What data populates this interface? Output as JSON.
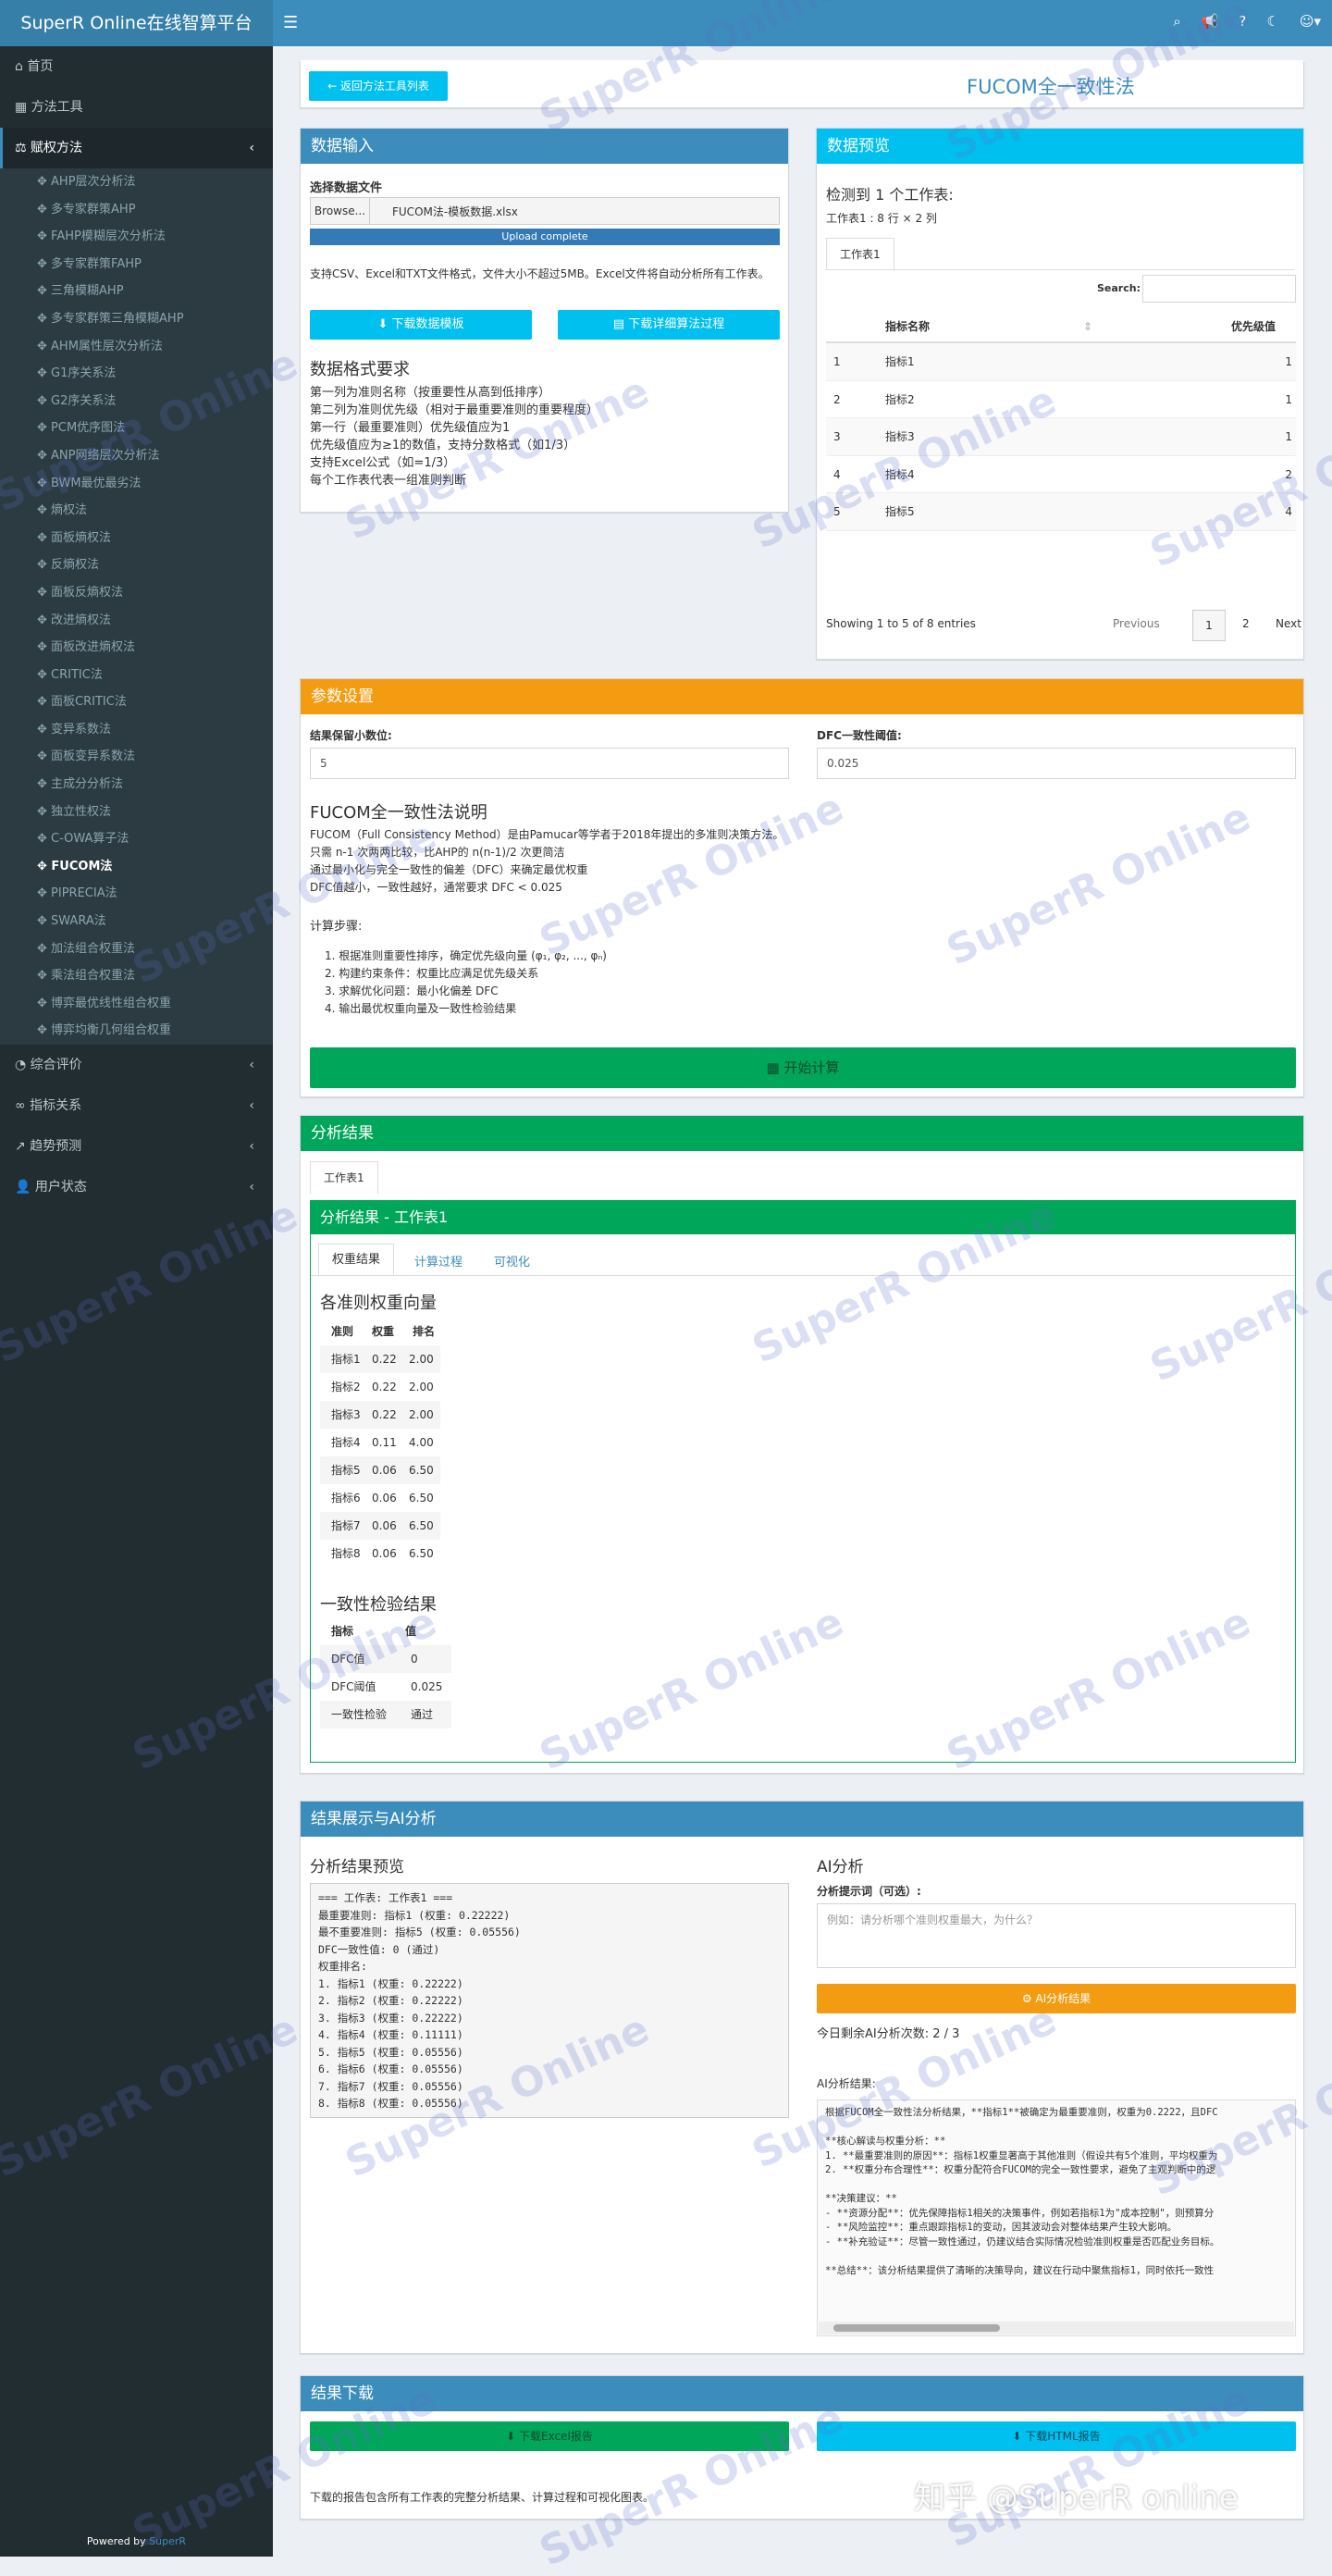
{
  "app": {
    "title": "SuperR Online在线智算平台",
    "powered": "Powered by",
    "powered_brand": "SuperR"
  },
  "sidebar": {
    "top": [
      {
        "label": "首页",
        "icon": "home-icon"
      },
      {
        "label": "方法工具",
        "icon": "table-icon"
      },
      {
        "label": "赋权方法",
        "icon": "balance-icon"
      }
    ],
    "sub": [
      "AHP层次分析法",
      "多专家群策AHP",
      "FAHP模糊层次分析法",
      "多专家群策FAHP",
      "三角模糊AHP",
      "多专家群策三角模糊AHP",
      "AHM属性层次分析法",
      "G1序关系法",
      "G2序关系法",
      "PCM优序图法",
      "ANP网络层次分析法",
      "BWM最优最劣法",
      "熵权法",
      "面板熵权法",
      "反熵权法",
      "面板反熵权法",
      "改进熵权法",
      "面板改进熵权法",
      "CRITIC法",
      "面板CRITIC法",
      "变异系数法",
      "面板变异系数法",
      "主成分分析法",
      "独立性权法",
      "C-OWA算子法",
      "FUCOM法",
      "PIPRECIA法",
      "SWARA法",
      "加法组合权重法",
      "乘法组合权重法",
      "博弈最优线性组合权重",
      "博弈均衡几何组合权重"
    ],
    "bottom": [
      {
        "label": "综合评价",
        "icon": "chart-pie-icon"
      },
      {
        "label": "指标关系",
        "icon": "link-icon"
      },
      {
        "label": "趋势预测",
        "icon": "line-chart-icon"
      },
      {
        "label": "用户状态",
        "icon": "user-icon"
      }
    ]
  },
  "header": {
    "back_label": "← 返回方法工具列表",
    "page_title": "FUCOM全一致性法"
  },
  "data_input": {
    "title": "数据输入",
    "file_label": "选择数据文件",
    "browse": "Browse...",
    "file_name": "FUCOM法-模板数据.xlsx",
    "upload_status": "Upload complete",
    "support_note": "支持CSV、Excel和TXT文件格式，文件大小不超过5MB。Excel文件将自动分析所有工作表。",
    "btn_template": "下载数据模板",
    "btn_process": "下载详细算法过程",
    "format_title": "数据格式要求",
    "format_lines": [
      "第一列为准则名称（按重要性从高到低排序）",
      "第二列为准则优先级（相对于最重要准则的重要程度）",
      "第一行（最重要准则）优先级值应为1",
      "优先级值应为≥1的数值，支持分数格式（如1/3）",
      "支持Excel公式（如=1/3）",
      "每个工作表代表一组准则判断"
    ]
  },
  "data_preview": {
    "title": "数据预览",
    "detected": "检测到 1 个工作表:",
    "sheet_info": "工作表1 : 8 行 × 2 列",
    "tab": "工作表1",
    "search_label": "Search:",
    "columns": [
      "",
      "指标名称",
      "优先级值"
    ],
    "rows": [
      [
        "1",
        "指标1",
        "1"
      ],
      [
        "2",
        "指标2",
        "1"
      ],
      [
        "3",
        "指标3",
        "1"
      ],
      [
        "4",
        "指标4",
        "2"
      ],
      [
        "5",
        "指标5",
        "4"
      ]
    ],
    "entries": "Showing 1 to 5 of 8 entries",
    "prev": "Previous",
    "pages": [
      "1",
      "2"
    ],
    "next": "Next"
  },
  "params": {
    "title": "参数设置",
    "decimal_label": "结果保留小数位:",
    "decimal_value": "5",
    "dfc_label": "DFC一致性阈值:",
    "dfc_value": "0.025",
    "desc_title": "FUCOM全一致性法说明",
    "desc_lines": [
      "FUCOM（Full Consistency Method）是由Pamucar等学者于2018年提出的多准则决策方法。",
      "只需 n-1 次两两比较，比AHP的 n(n-1)/2 次更简洁",
      "通过最小化与完全一致性的偏差（DFC）来确定最优权重",
      "DFC值越小，一致性越好，通常要求 DFC < 0.025"
    ],
    "steps_title": "计算步骤:",
    "steps": [
      "1. 根据准则重要性排序，确定优先级向量 (φ₁, φ₂, ..., φₙ)",
      "2. 构建约束条件：权重比应满足优先级关系",
      "3. 求解优化问题：最小化偏差 DFC",
      "4. 输出最优权重向量及一致性检验结果"
    ],
    "start_btn": "开始计算"
  },
  "results": {
    "title": "分析结果",
    "tab": "工作表1",
    "sub_title": "分析结果 - 工作表1",
    "inner_tabs": [
      "权重结果",
      "计算过程",
      "可视化"
    ],
    "weights_title": "各准则权重向量",
    "weights_cols": [
      "准则",
      "权重",
      "排名"
    ],
    "weights": [
      [
        "指标1",
        "0.22",
        "2.00"
      ],
      [
        "指标2",
        "0.22",
        "2.00"
      ],
      [
        "指标3",
        "0.22",
        "2.00"
      ],
      [
        "指标4",
        "0.11",
        "4.00"
      ],
      [
        "指标5",
        "0.06",
        "6.50"
      ],
      [
        "指标6",
        "0.06",
        "6.50"
      ],
      [
        "指标7",
        "0.06",
        "6.50"
      ],
      [
        "指标8",
        "0.06",
        "6.50"
      ]
    ],
    "check_title": "一致性检验结果",
    "check_cols": [
      "指标",
      "值"
    ],
    "check": [
      [
        "DFC值",
        "0"
      ],
      [
        "DFC阈值",
        "0.025"
      ],
      [
        "一致性检验",
        "通过"
      ]
    ]
  },
  "ai": {
    "title": "结果展示与AI分析",
    "preview_title": "分析结果预览",
    "preview_text": "=== 工作表: 工作表1 ===\n最重要准则: 指标1 (权重: 0.22222)\n最不重要准则: 指标5 (权重: 0.05556)\nDFC一致性值: 0 (通过)\n权重排名:\n1. 指标1 (权重: 0.22222)\n2. 指标2 (权重: 0.22222)\n3. 指标3 (权重: 0.22222)\n4. 指标4 (权重: 0.11111)\n5. 指标5 (权重: 0.05556)\n6. 指标6 (权重: 0.05556)\n7. 指标7 (权重: 0.05556)\n8. 指标8 (权重: 0.05556)",
    "ai_title": "AI分析",
    "prompt_label": "分析提示词（可选）:",
    "prompt_placeholder": "例如：请分析哪个准则权重最大，为什么？",
    "ai_btn": "AI分析结果",
    "remaining": "今日剩余AI分析次数: 2 / 3",
    "result_label": "AI分析结果:",
    "result_text": "根据FUCOM全一致性法分析结果，**指标1**被确定为最重要准则，权重为0.2222，且DFC\n\n**核心解读与权重分析：**\n1. **最重要准则的原因**：指标1权重显著高于其他准则（假设共有5个准则，平均权重为\n2. **权重分布合理性**：权重分配符合FUCOM的完全一致性要求，避免了主观判断中的逻\n\n**决策建议：**\n- **资源分配**：优先保障指标1相关的决策事件，例如若指标1为\"成本控制\"，则预算分\n- **风险监控**：重点跟踪指标1的变动，因其波动会对整体结果产生较大影响。\n- **补充验证**：尽管一致性通过，仍建议结合实际情况检验准则权重是否匹配业务目标。\n\n**总结**：该分析结果提供了清晰的决策导向，建议在行动中聚焦指标1，同时依托一致性"
  },
  "download": {
    "title": "结果下载",
    "excel_btn": "下载Excel报告",
    "html_btn": "下载HTML报告",
    "note": "下载的报告包含所有工作表的完整分析结果、计算过程和可视化图表。"
  },
  "overlay": {
    "zhihu": "知乎 @SuperR online",
    "wm": "SuperR Online"
  },
  "colors": {
    "blue": "#3c8dbc",
    "cyan": "#00c0ef",
    "orange": "#f39c12",
    "green": "#00a65a",
    "sidebar": "#222d32"
  }
}
